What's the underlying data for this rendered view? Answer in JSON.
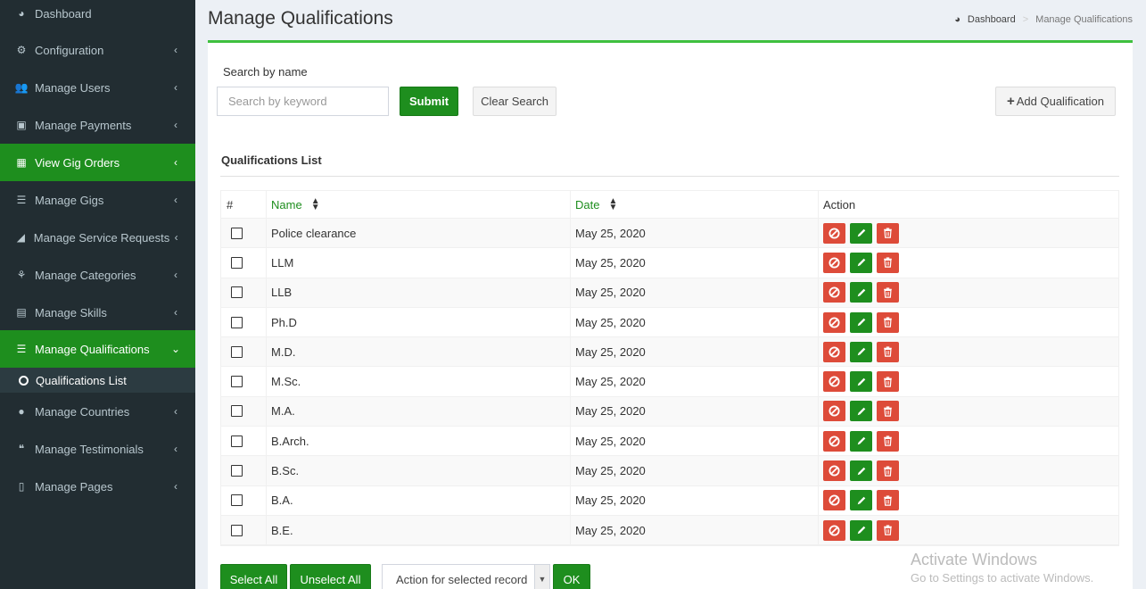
{
  "sidebar": {
    "items": [
      {
        "label": "Dashboard",
        "icon": "dashboard-icon",
        "glyph": "◕",
        "chevron": ""
      },
      {
        "label": "Configuration",
        "icon": "cogs-icon",
        "glyph": "⚙",
        "chevron": "‹"
      },
      {
        "label": "Manage Users",
        "icon": "users-icon",
        "glyph": "👥",
        "chevron": "‹"
      },
      {
        "label": "Manage Payments",
        "icon": "money-icon",
        "glyph": "▣",
        "chevron": "‹"
      },
      {
        "label": "View Gig Orders",
        "icon": "table-icon",
        "glyph": "▦",
        "chevron": "‹"
      },
      {
        "label": "Manage Gigs",
        "icon": "list-alt-icon",
        "glyph": "☰",
        "chevron": "‹"
      },
      {
        "label": "Manage Service Requests",
        "icon": "signal-icon",
        "glyph": "◢",
        "chevron": "‹"
      },
      {
        "label": "Manage Categories",
        "icon": "sitemap-icon",
        "glyph": "⚘",
        "chevron": "‹"
      },
      {
        "label": "Manage Skills",
        "icon": "book-icon",
        "glyph": "▤",
        "chevron": "‹"
      },
      {
        "label": "Manage Qualifications",
        "icon": "list-icon",
        "glyph": "☰",
        "chevron": "⌄"
      },
      {
        "label": "Manage Countries",
        "icon": "globe-icon",
        "glyph": "●",
        "chevron": "‹"
      },
      {
        "label": "Manage Testimonials",
        "icon": "quote-icon",
        "glyph": "❝",
        "chevron": "‹"
      },
      {
        "label": "Manage Pages",
        "icon": "file-icon",
        "glyph": "▯",
        "chevron": "‹"
      }
    ],
    "sub_item": "Qualifications List"
  },
  "header": {
    "title": "Manage Qualifications",
    "breadcrumb_home": "Dashboard",
    "breadcrumb_sep": ">",
    "breadcrumb_current": "Manage Qualifications"
  },
  "search": {
    "label": "Search by name",
    "placeholder": "Search by keyword",
    "submit": "Submit",
    "clear": "Clear Search",
    "add": "Add Qualification"
  },
  "list": {
    "title": "Qualifications List",
    "columns": {
      "hash": "#",
      "name": "Name",
      "date": "Date",
      "action": "Action"
    },
    "rows": [
      {
        "name": "Police clearance",
        "date": "May 25, 2020"
      },
      {
        "name": "LLM",
        "date": "May 25, 2020"
      },
      {
        "name": "LLB",
        "date": "May 25, 2020"
      },
      {
        "name": "Ph.D",
        "date": "May 25, 2020"
      },
      {
        "name": "M.D.",
        "date": "May 25, 2020"
      },
      {
        "name": "M.Sc.",
        "date": "May 25, 2020"
      },
      {
        "name": "M.A.",
        "date": "May 25, 2020"
      },
      {
        "name": "B.Arch.",
        "date": "May 25, 2020"
      },
      {
        "name": "B.Sc.",
        "date": "May 25, 2020"
      },
      {
        "name": "B.A.",
        "date": "May 25, 2020"
      },
      {
        "name": "B.E.",
        "date": "May 25, 2020"
      }
    ]
  },
  "bottom": {
    "select_all": "Select All",
    "unselect_all": "Unselect All",
    "action_select": "Action for selected record",
    "ok": "OK"
  },
  "watermark": {
    "line1": "Activate Windows",
    "line2": "Go to Settings to activate Windows."
  },
  "colors": {
    "brand_green": "#1e8e1e",
    "danger_red": "#dd4b39",
    "sidebar_bg": "#222d32"
  }
}
